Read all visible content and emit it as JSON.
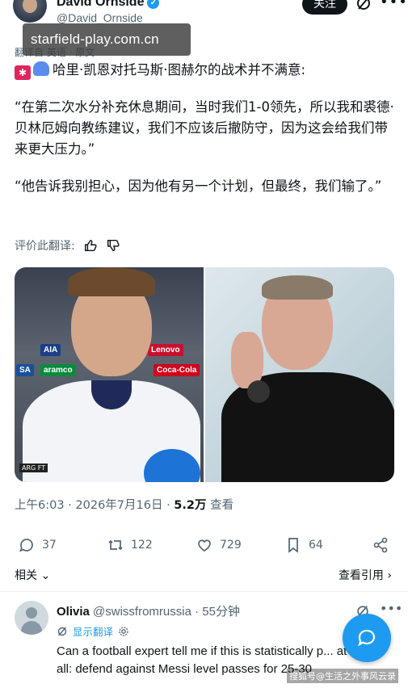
{
  "author": {
    "name": "David Ornside",
    "handle": "@David_Ornside",
    "follow_label": "关注"
  },
  "watermark": "starfield-play.com.cn",
  "translate_meta": "翻译自 英语 · 原文",
  "tweet": {
    "line1": "哈里·凯恩对托马斯·图赫尔的战术并不满意:",
    "para2": "“在第二次水分补充休息期间，当时我们1-0领先，所以我和裘德·贝林厄姆向教练建议，我们不应该后撤防守，因为这会给我们带来更大压力。”",
    "para3": "“他告诉我别担心，因为他有另一个计划，但最终，我们输了。”"
  },
  "rate_label": "评价此翻译:",
  "media": {
    "left_ads": [
      "Lenovo",
      "Coca-Cola",
      "aramco",
      "SA",
      "AIA"
    ],
    "tag": "ARG FT"
  },
  "meta": {
    "time": "上午6:03 · 2026年7月16日 · ",
    "views": "5.2万",
    "views_label": " 查看"
  },
  "actions": {
    "replies": "37",
    "retweets": "122",
    "likes": "729",
    "bookmarks": "64"
  },
  "related_label": "相关",
  "quotes_label": "查看引用",
  "reply": {
    "name": "Olivia",
    "handle": "@swissfromrussia",
    "time": " · 55分钟",
    "show_translation": "显示翻译",
    "text": "Can a football expert tell me if this is statistically p... at all: defend against Messi level passes for 25-30"
  },
  "credit": "搜狐号@生活之外事风云录",
  "colors": {
    "accent": "#1d9bf0",
    "text": "#0f1419",
    "muted": "#536471"
  }
}
